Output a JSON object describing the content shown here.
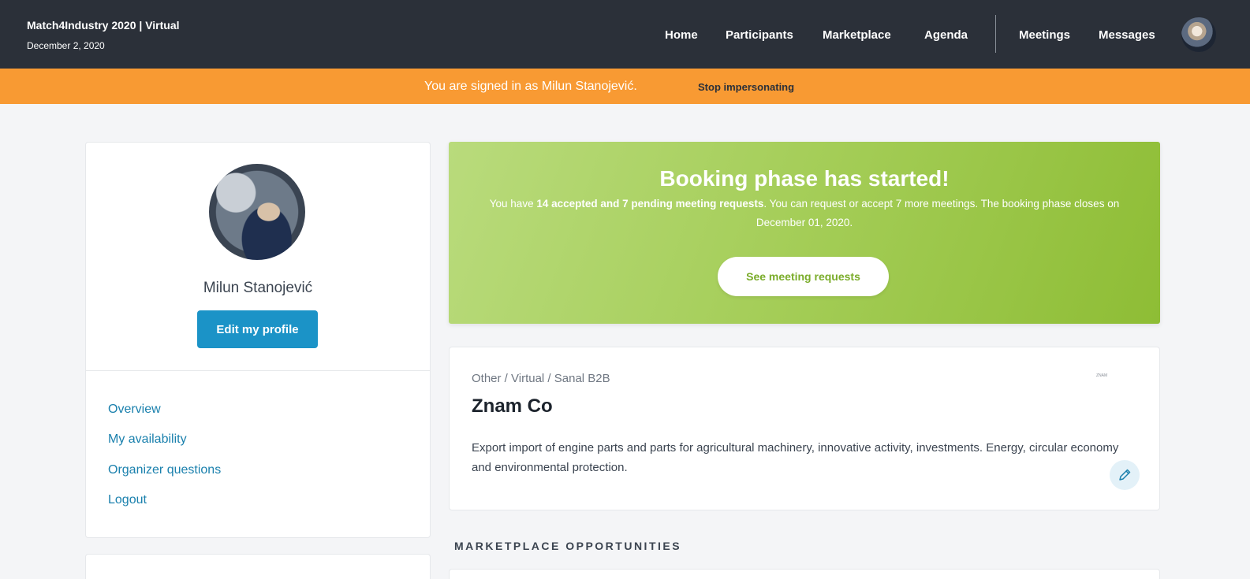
{
  "header": {
    "event_title": "Match4Industry 2020 | Virtual",
    "event_date": "December 2, 2020",
    "nav": {
      "home": "Home",
      "participants": "Participants",
      "marketplace": "Marketplace",
      "agenda": "Agenda",
      "meetings": "Meetings",
      "messages": "Messages"
    }
  },
  "impersonation": {
    "message": "You are signed in as Milun Stanojević.",
    "stop_label": "Stop impersonating"
  },
  "profile": {
    "name": "Milun Stanojević",
    "edit_label": "Edit my profile",
    "links": {
      "overview": "Overview",
      "availability": "My availability",
      "organizer_questions": "Organizer questions",
      "logout": "Logout"
    }
  },
  "banner": {
    "title": "Booking phase has started!",
    "text_prefix": "You have ",
    "text_bold": "14 accepted and 7 pending meeting requests",
    "text_suffix": ". You can request or accept 7 more meetings. The booking phase closes on December 01, 2020.",
    "button_label": "See meeting requests"
  },
  "company": {
    "breadcrumb": "Other / Virtual / Sanal B2B",
    "name": "Znam Co",
    "description": "Export import of engine parts and parts for agricultural machinery, innovative activity, investments. Energy, circular economy and environmental protection.",
    "logo_text": "ZNAM"
  },
  "marketplace": {
    "heading": "MARKETPLACE OPPORTUNITIES"
  }
}
